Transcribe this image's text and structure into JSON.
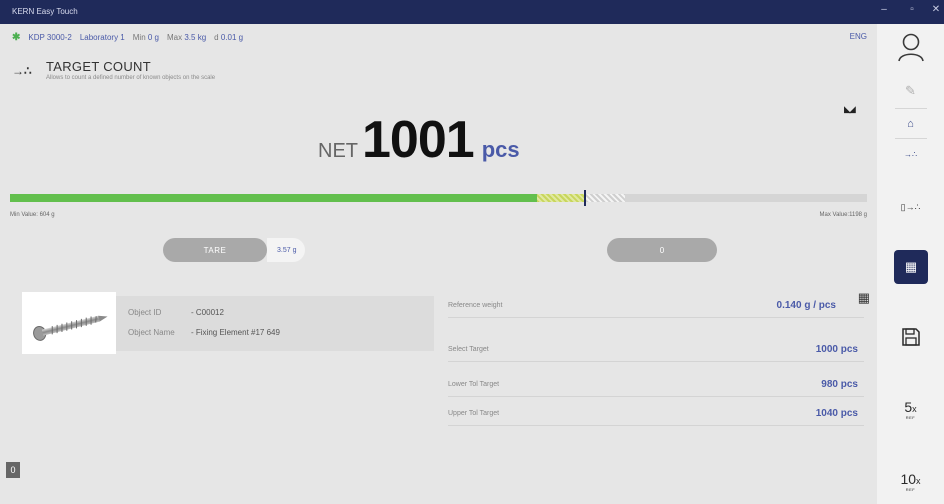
{
  "window": {
    "title": "KERN Easy Touch",
    "minimize": "–",
    "maximize": "▫",
    "close": "✕"
  },
  "infobar": {
    "device": "KDP 3000-2",
    "location": "Laboratory 1",
    "min_label": "Min",
    "min_value": "0 g",
    "max_label": "Max",
    "max_value": "3.5 kg",
    "d_label": "d",
    "d_value": "0.01 g",
    "language": "ENG"
  },
  "mode": {
    "title": "TARGET COUNT",
    "description": "Allows to count a defined number of known objects on the scale"
  },
  "readout": {
    "label": "NET",
    "value": "1001",
    "unit": "pcs"
  },
  "bar": {
    "min_label": "Min Value: 604 g",
    "max_label": "Max Value:1198 g",
    "green_fraction": 0.615,
    "yellow_fraction": 0.055,
    "marker_fraction": 0.67,
    "checker_fraction": 0.045
  },
  "tare": {
    "label": "TARE",
    "value": "3.57 g"
  },
  "zero": {
    "label": "0"
  },
  "object": {
    "id_label": "Object ID",
    "id_value": "- C00012",
    "name_label": "Object Name",
    "name_value": "- Fixing Element #17 649"
  },
  "params": [
    {
      "label": "Reference weight",
      "value": "0.140  g / pcs"
    },
    {
      "label": "Select Target",
      "value": "1000 pcs"
    },
    {
      "label": "Lower Tol Target",
      "value": "980 pcs"
    },
    {
      "label": "Upper Tol Target",
      "value": "1040 pcs"
    }
  ],
  "footer": {
    "tag": "0"
  },
  "sidebar": {
    "ref5_main": "5",
    "ref5_sub": "x",
    "ref5_caption": "REF",
    "ref10_main": "10",
    "ref10_sub": "x",
    "ref10_caption": "REF"
  },
  "colors": {
    "accent": "#4a5aa8",
    "navy": "#1f2a5a",
    "progress_green": "#62bf4d"
  }
}
